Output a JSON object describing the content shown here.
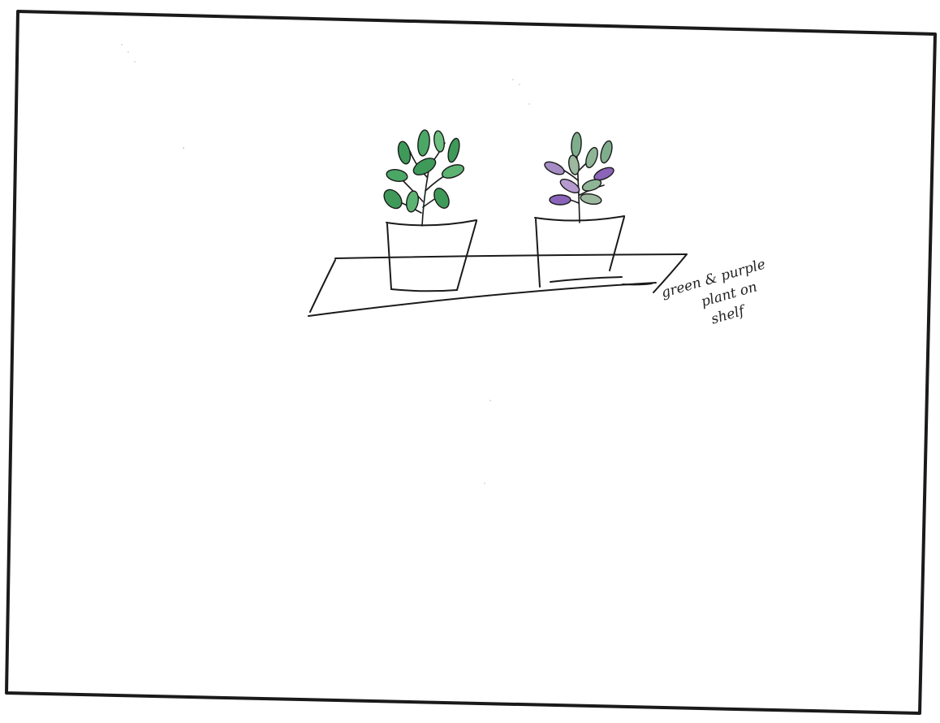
{
  "caption": {
    "line1": "green & purple",
    "line2": "plant on",
    "line3": "shelf"
  },
  "colors": {
    "ink": "#1a1a1a",
    "green_leaf": "#3f9a5a",
    "green_leaf_light": "#6cbf80",
    "purple_tint": "#8a64b8",
    "paper": "#ffffff"
  }
}
